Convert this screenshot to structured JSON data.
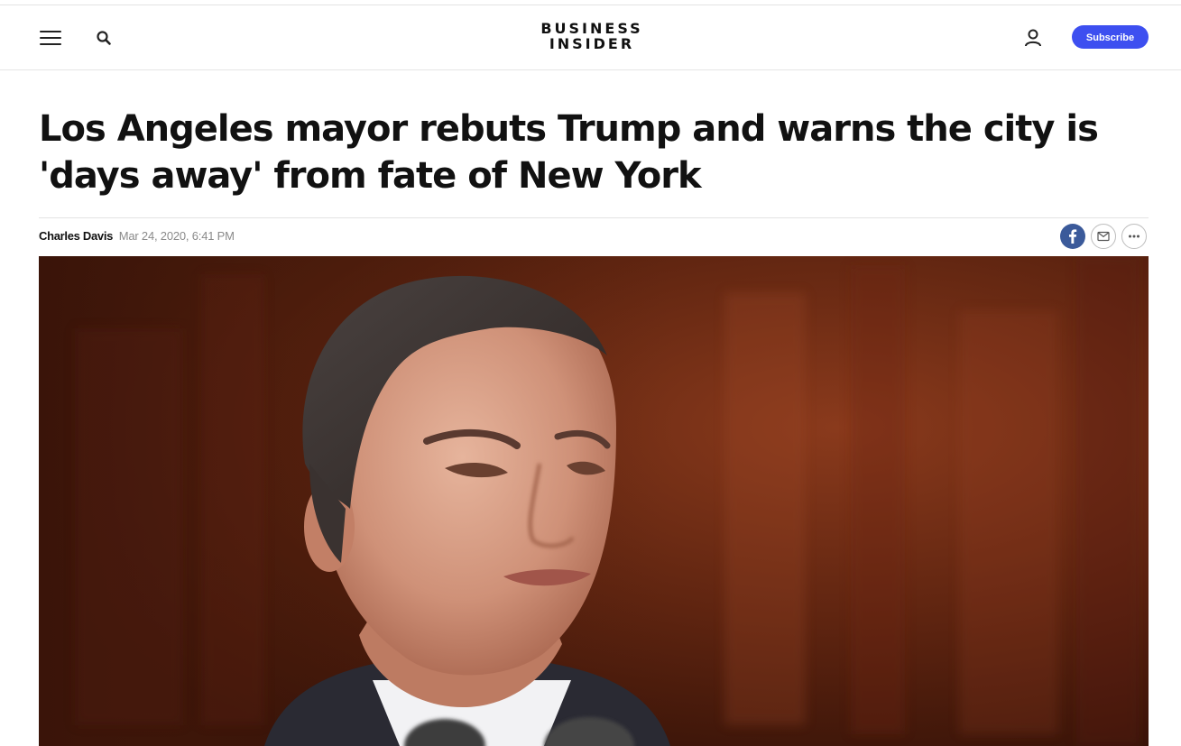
{
  "header": {
    "logo_line1": "BUSINESS",
    "logo_line2": "INSIDER",
    "subscribe_label": "Subscribe"
  },
  "article": {
    "headline": "Los Angeles mayor rebuts Trump and warns the city is 'days away' from fate of New York",
    "author": "Charles Davis",
    "date": "Mar 24, 2020, 6:41 PM"
  },
  "icons": {
    "menu": "hamburger-menu-icon",
    "search": "search-icon",
    "account": "user-icon",
    "share_facebook": "facebook-icon",
    "share_email": "email-icon",
    "share_more": "more-icon"
  },
  "colors": {
    "accent": "#3d4ff0",
    "facebook": "#3b5a9a",
    "text": "#111111",
    "muted": "#8a8a8a"
  }
}
